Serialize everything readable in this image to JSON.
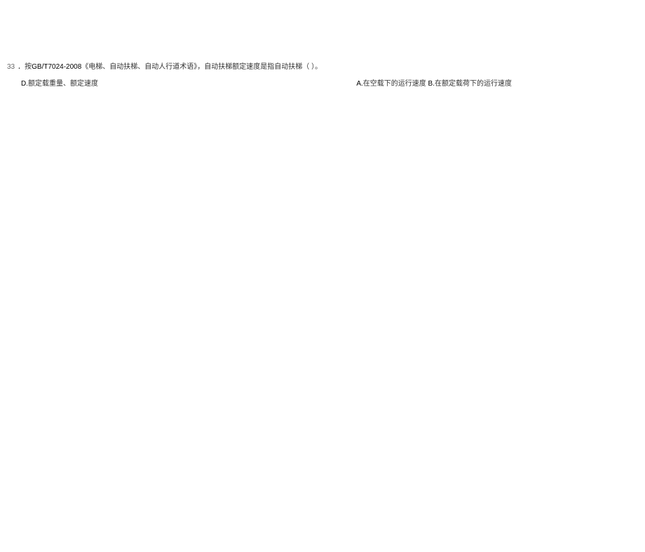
{
  "question": {
    "number": "33",
    "prefix": "．按",
    "gb_code": "GB/T7024-2008",
    "stem_text": "《电梯、自动扶梯、自动人行道术语》，自动扶梯额定速度是指自动扶梯（ ）。"
  },
  "options": {
    "A_letter": "A.",
    "A_text": "在空载下的运行速度",
    "B_letter": "B.",
    "B_text": "在额定载荷下的运行速度",
    "D_letter": "D.",
    "D_text": "额定载重量、额定速度"
  }
}
